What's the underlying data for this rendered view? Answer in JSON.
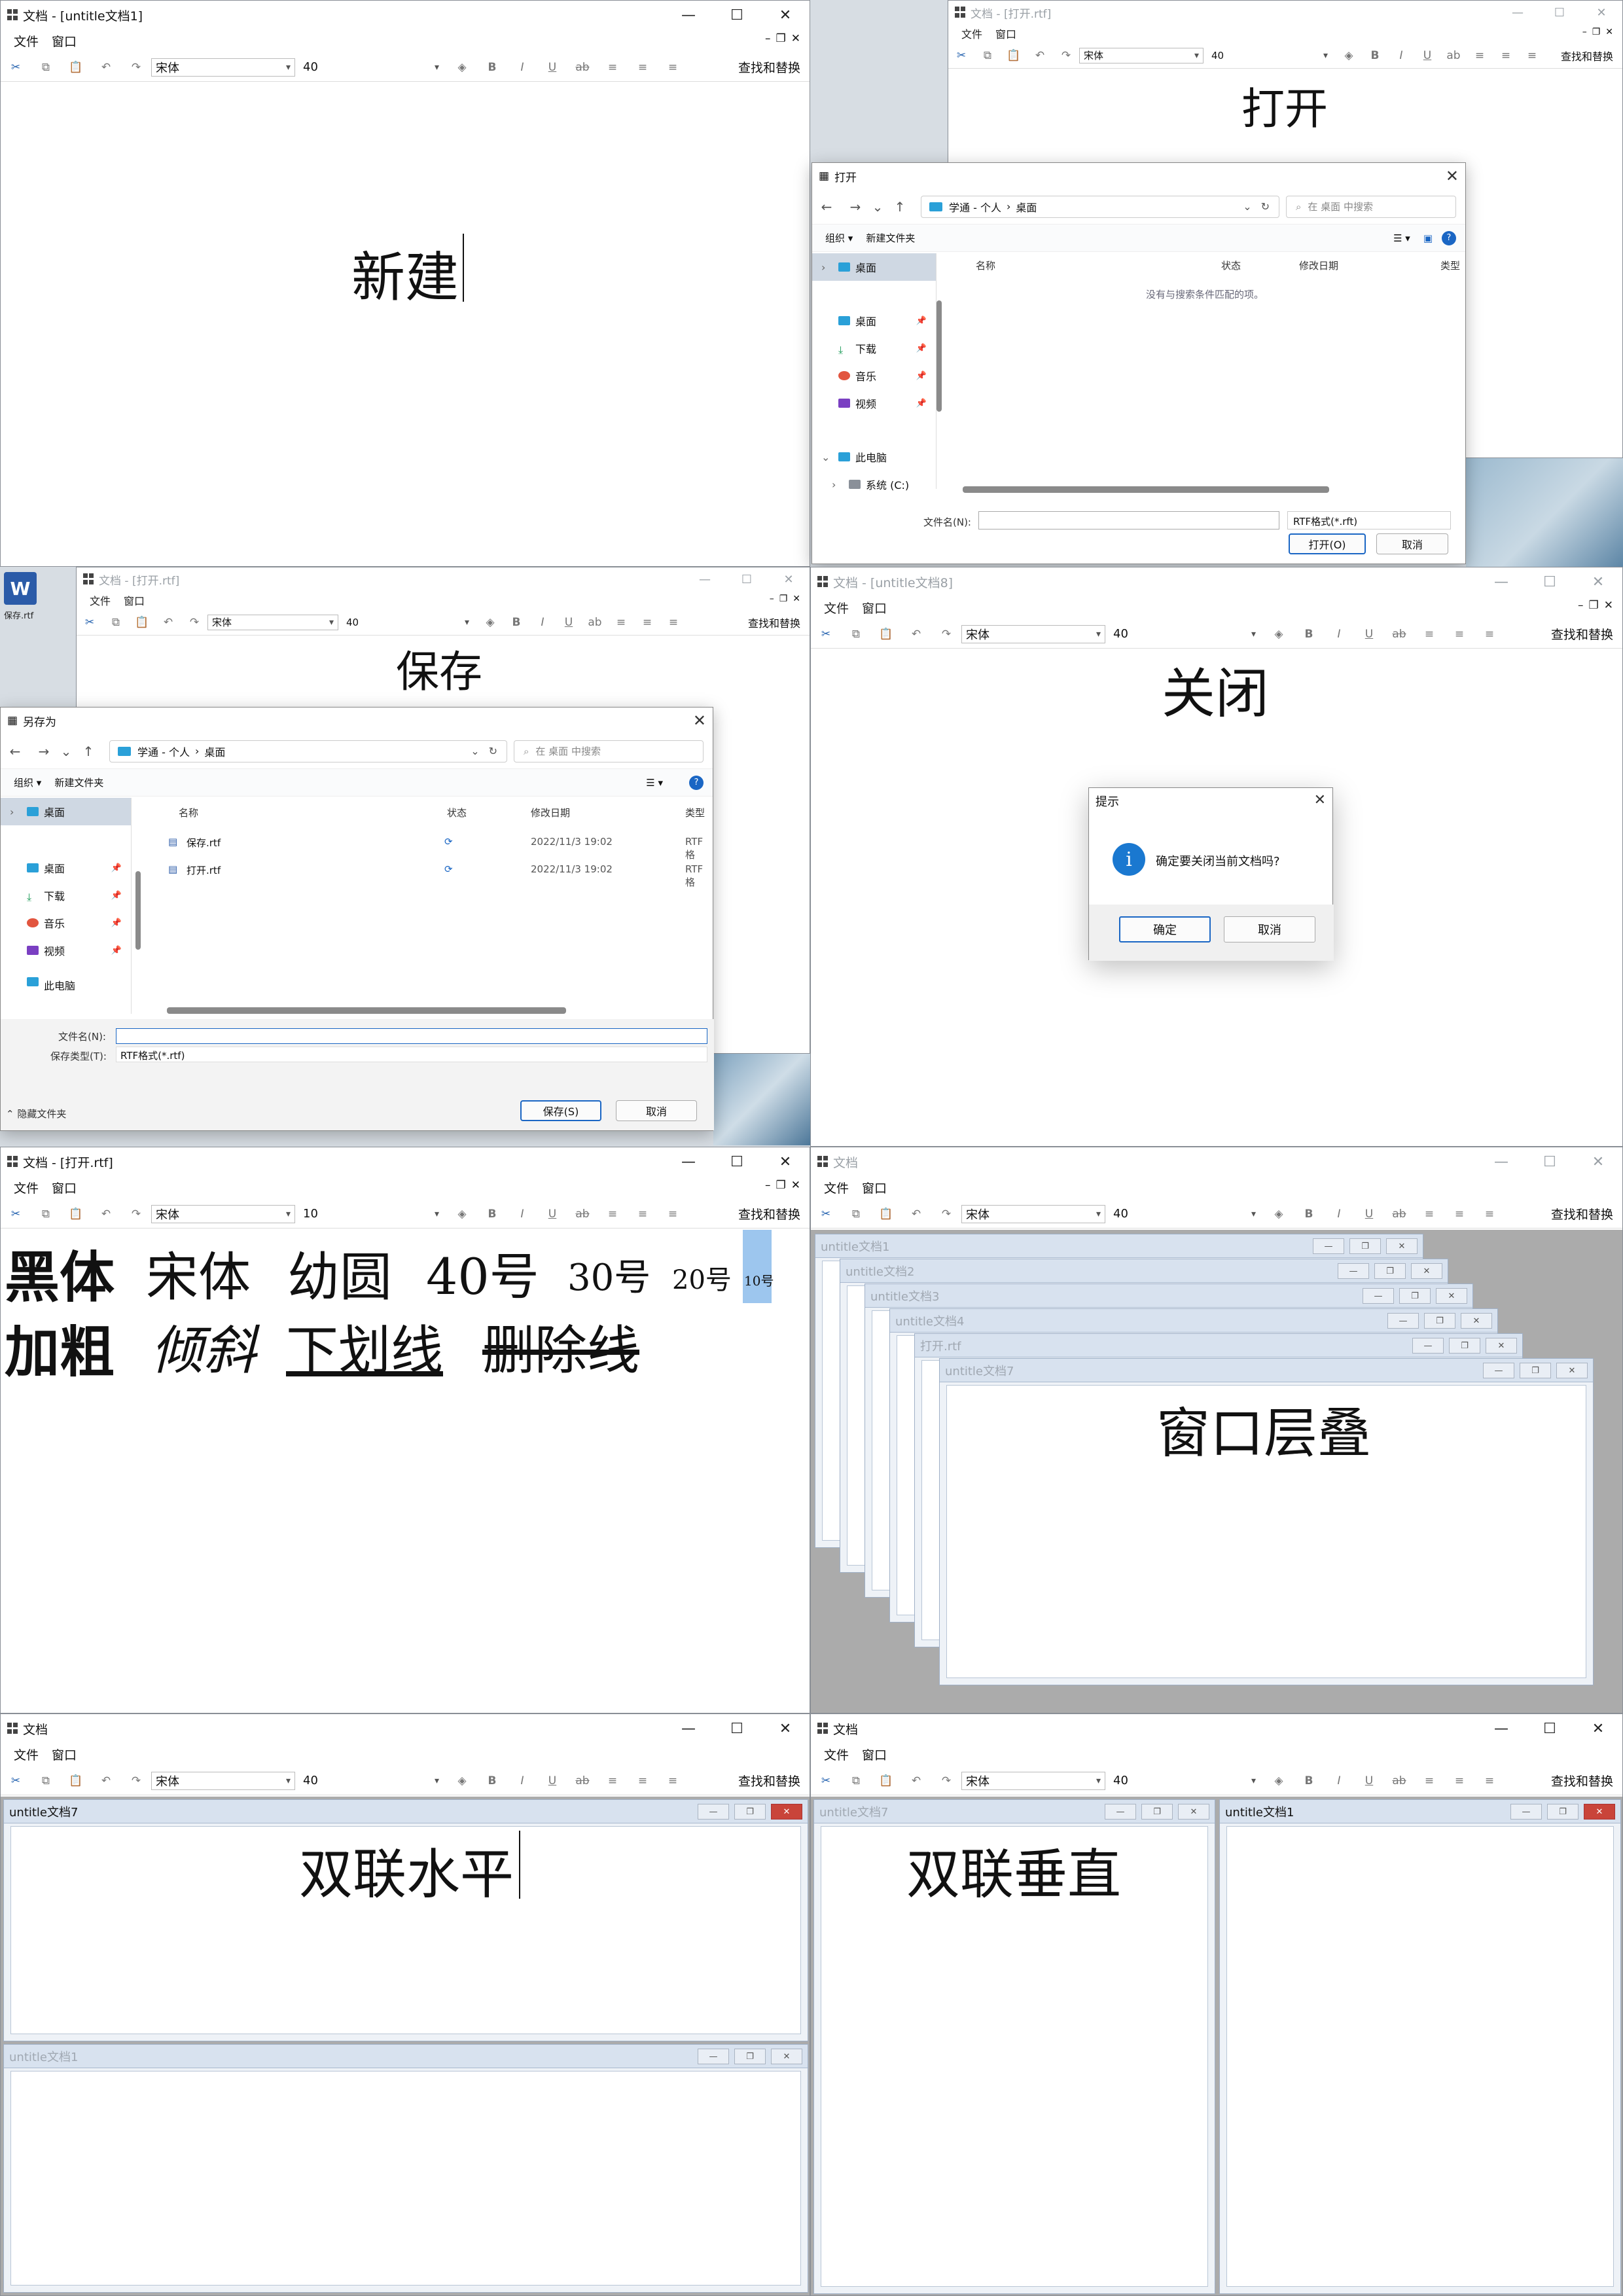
{
  "panels": {
    "new": {
      "title": "文档 - [untitle文档1]",
      "menu": [
        "文件",
        "窗口"
      ],
      "font": "宋体",
      "size": "40",
      "find": "查找和替换",
      "content": "新建"
    },
    "open": {
      "title": "文档 - [打开.rtf]",
      "menu": [
        "文件",
        "窗口"
      ],
      "font": "宋体",
      "size": "40",
      "find": "查找和替换",
      "content": "打开",
      "dialog": {
        "title": "打开",
        "path": [
          "学通 - 个人",
          "›",
          "桌面"
        ],
        "search": "在 桌面 中搜索",
        "organize": "组织 ▾",
        "new_folder": "新建文件夹",
        "side": [
          "桌面",
          "桌面",
          "下载",
          "音乐",
          "视频",
          "此电脑",
          "系统 (C:)"
        ],
        "cols": [
          "名称",
          "状态",
          "修改日期",
          "类型"
        ],
        "empty": "没有与搜索条件匹配的项。",
        "filename_label": "文件名(N):",
        "filter": "RTF格式(*.rft)",
        "ok": "打开(O)",
        "cancel": "取消"
      }
    },
    "save": {
      "title": "文档 - [打开.rtf]",
      "menu": [
        "文件",
        "窗口"
      ],
      "font": "宋体",
      "size": "40",
      "find": "查找和替换",
      "content": "保存",
      "desktop_icon": "保存.rtf",
      "dialog": {
        "title": "另存为",
        "path": [
          "学通 - 个人",
          "›",
          "桌面"
        ],
        "search": "在 桌面 中搜索",
        "organize": "组织 ▾",
        "new_folder": "新建文件夹",
        "side": [
          "桌面",
          "桌面",
          "下载",
          "音乐",
          "视频",
          "此电脑"
        ],
        "cols": [
          "名称",
          "状态",
          "修改日期",
          "类型"
        ],
        "files": [
          {
            "name": "保存.rtf",
            "date": "2022/11/3 19:02",
            "type": "RTF 格"
          },
          {
            "name": "打开.rtf",
            "date": "2022/11/3 19:02",
            "type": "RTF 格"
          }
        ],
        "filename_label": "文件名(N):",
        "type_label": "保存类型(T):",
        "type_value": "RTF格式(*.rtf)",
        "hide": "隐藏文件夹",
        "ok": "保存(S)",
        "cancel": "取消"
      }
    },
    "close": {
      "title": "文档 - [untitle文档8]",
      "menu": [
        "文件",
        "窗口"
      ],
      "font": "宋体",
      "size": "40",
      "find": "查找和替换",
      "content": "关闭",
      "dialog": {
        "title": "提示",
        "message": "确定要关闭当前文档吗?",
        "ok": "确定",
        "cancel": "取消"
      }
    },
    "format": {
      "title": "文档 - [打开.rtf]",
      "menu": [
        "文件",
        "窗口"
      ],
      "font": "宋体",
      "size": "10",
      "find": "查找和替换",
      "row1": [
        "黑体",
        "宋体",
        "幼圆",
        "40号",
        "30号",
        "20号",
        "10号"
      ],
      "row2": [
        "加粗",
        "倾斜",
        "下划线",
        "删除线"
      ]
    },
    "cascade": {
      "title": "文档",
      "menu": [
        "文件",
        "窗口"
      ],
      "font": "宋体",
      "size": "40",
      "find": "查找和替换",
      "children": [
        "untitle文档1",
        "untitle文档2",
        "untitle文档3",
        "untitle文档4",
        "打开.rtf",
        "untitle文档7"
      ],
      "content": "窗口层叠"
    },
    "horizontal": {
      "title": "文档",
      "menu": [
        "文件",
        "窗口"
      ],
      "font": "宋体",
      "size": "40",
      "find": "查找和替换",
      "children": [
        "untitle文档7",
        "untitle文档1"
      ],
      "content": "双联水平"
    },
    "vertical": {
      "title": "文档",
      "menu": [
        "文件",
        "窗口"
      ],
      "font": "宋体",
      "size": "40",
      "find": "查找和替换",
      "children": [
        "untitle文档7",
        "untitle文档1"
      ],
      "content": "双联垂直"
    }
  },
  "colors": {
    "accent": "#1a66c4",
    "folder": "#2aa0d8",
    "selected": "#cfd8e3",
    "mdi_title": "#d8e2ef",
    "close_red": "#c9443a"
  }
}
